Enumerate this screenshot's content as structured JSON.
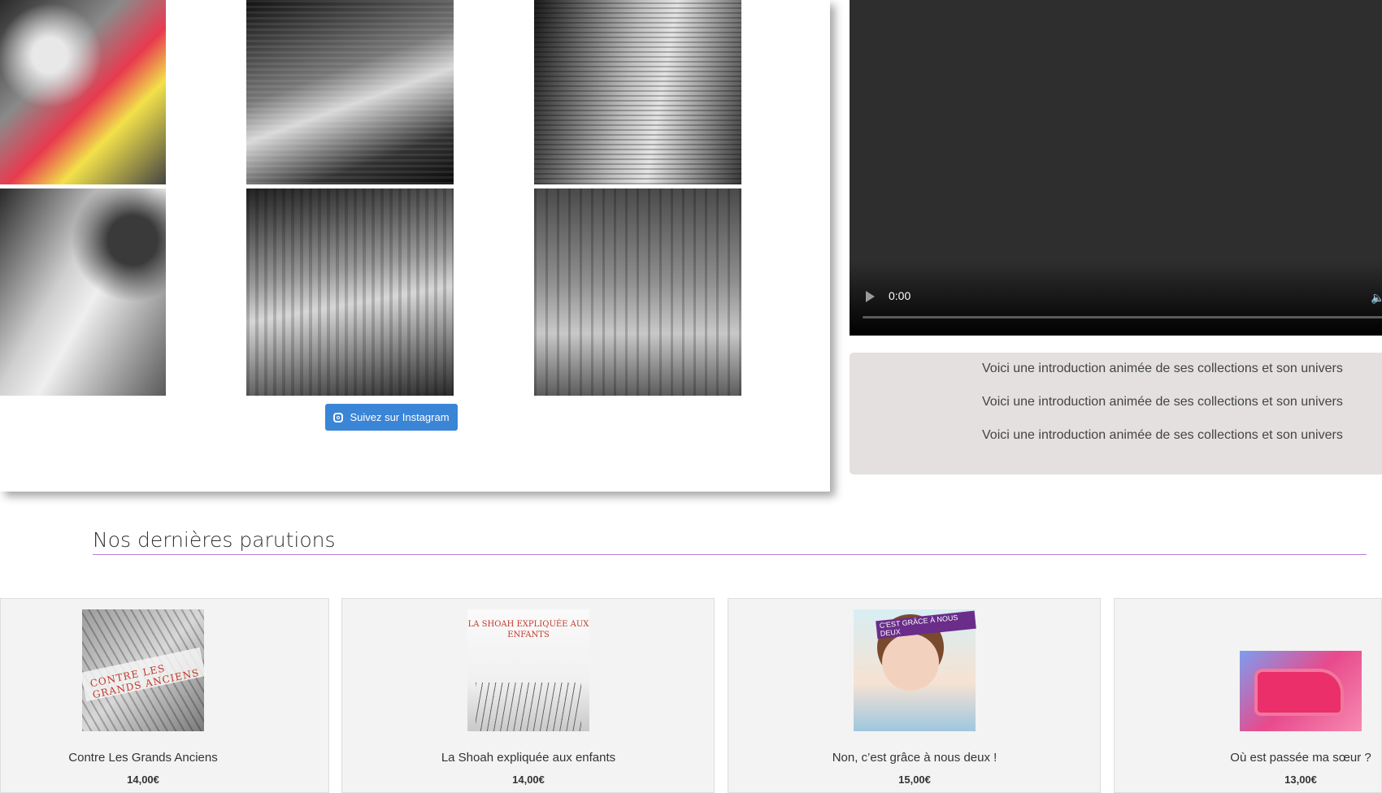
{
  "instagram_feed": {
    "follow_button_label": "Suivez sur Instagram",
    "icon": "instagram-icon"
  },
  "video_player": {
    "current_time": "0:00",
    "progress": 0,
    "icons": [
      "play-icon",
      "volume-icon"
    ]
  },
  "intro": {
    "lines": [
      "Voici une introduction animée de ses collections et son univers",
      "Voici une introduction animée de ses collections et son univers",
      "Voici une introduction animée de ses collections et son univers"
    ]
  },
  "section": {
    "title": "Nos dernières parutions"
  },
  "products": [
    {
      "title": "Contre Les Grands Anciens",
      "price": "14,00€",
      "cover_text": "CONTRE LES GRANDS ANCIENS"
    },
    {
      "title": "La Shoah expliquée aux enfants",
      "price": "14,00€",
      "cover_text": "LA SHOAH EXPLIQUÉE AUX ENFANTS"
    },
    {
      "title": "Non, c’est grâce à nous deux !",
      "price": "15,00€",
      "cover_text": "C'EST GRÂCE À NOUS DEUX"
    },
    {
      "title": "Où est passée ma sœur ?",
      "price": "13,00€"
    }
  ],
  "colors": {
    "instagram_button": "#3a85d6",
    "section_underline": "#b57bd8",
    "intro_background": "#e4e0e0",
    "video_background": "#2e2e2e"
  }
}
